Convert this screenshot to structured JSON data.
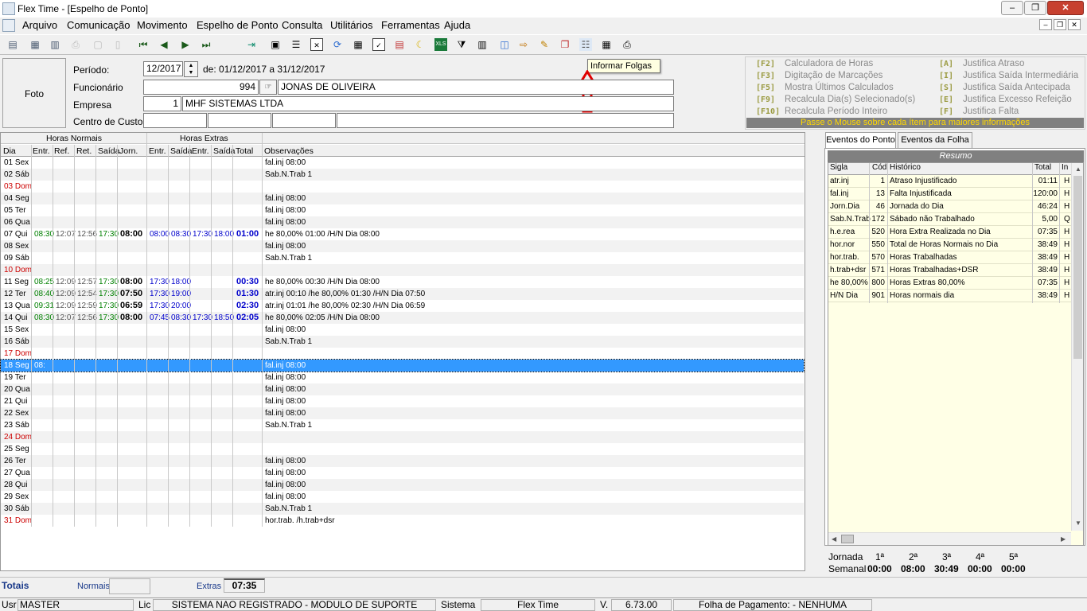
{
  "window": {
    "title": "Flex Time - [Espelho de Ponto]",
    "min_glyph": "–",
    "max_glyph": "❐",
    "close_glyph": "✕"
  },
  "menu": [
    "Arquivo",
    "Comunicação",
    "Movimento",
    "Espelho de Ponto",
    "Consulta",
    "Utilitários",
    "Ferramentas",
    "Ajuda"
  ],
  "tooltip": "Informar Folgas",
  "header": {
    "foto": "Foto",
    "periodo_label": "Período:",
    "periodo_value": "12/2017",
    "periodo_range": "de: 01/12/2017 a 31/12/2017",
    "funcionario_label": "Funcionário",
    "funcionario_id": "994",
    "funcionario_name": "JONAS DE OLIVEIRA",
    "empresa_label": "Empresa",
    "empresa_id": "1",
    "empresa_name": "MHF SISTEMAS LTDA",
    "centro_label": "Centro de Custos"
  },
  "shortcuts": [
    {
      "key": "[F2]",
      "label": "Calculadora de Horas"
    },
    {
      "key": "[F3]",
      "label": "Digitação de Marcações"
    },
    {
      "key": "[F5]",
      "label": "Mostra Últimos Calculados"
    },
    {
      "key": "[F9]",
      "label": "Recalcula Dia(s) Selecionado(s)"
    },
    {
      "key": "[F10]",
      "label": "Recalcula Período Inteiro"
    },
    {
      "key": "[A]",
      "label": "Justifica Atraso"
    },
    {
      "key": "[I]",
      "label": "Justifica Saída Intermediária"
    },
    {
      "key": "[S]",
      "label": "Justifica Saída Antecipada"
    },
    {
      "key": "[E]",
      "label": "Justifica Excesso Refeição"
    },
    {
      "key": "[F]",
      "label": "Justifica Falta"
    }
  ],
  "shortcut_hint": "Passe o Mouse sobre cada ítem para maiores informações",
  "grid": {
    "group_normais": "Horas Normais",
    "group_extras": "Horas Extras",
    "columns": [
      "Dia",
      "Entr.",
      "Ref.",
      "Ret.",
      "Saída",
      "Jorn.",
      "Entr.",
      "Saída",
      "Entr.",
      "Saída",
      "Total",
      "Observações"
    ],
    "rows": [
      {
        "dia": "01 Sex",
        "obs": "fal.inj 08:00"
      },
      {
        "dia": "02 Sáb",
        "obs": "Sab.N.Trab 1"
      },
      {
        "dia": "03 Dom",
        "red": true
      },
      {
        "dia": "04 Seg",
        "obs": "fal.inj 08:00"
      },
      {
        "dia": "05 Ter",
        "obs": "fal.inj 08:00"
      },
      {
        "dia": "06 Qua",
        "obs": "fal.inj 08:00"
      },
      {
        "dia": "07 Qui",
        "entr": "08:30",
        "ref": "12:07",
        "ret": "12:56",
        "saida": "17:30",
        "jorn": "08:00",
        "e1": "08:00",
        "s1": "08:30",
        "e2": "17:30",
        "s2": "18:00",
        "total": "01:00",
        "obs": "he 80,00% 01:00 /H/N Dia 08:00"
      },
      {
        "dia": "08 Sex",
        "obs": "fal.inj 08:00"
      },
      {
        "dia": "09 Sáb",
        "obs": "Sab.N.Trab 1"
      },
      {
        "dia": "10 Dom",
        "red": true
      },
      {
        "dia": "11 Seg",
        "entr": "08:25",
        "ref": "12:09",
        "ret": "12:57",
        "saida": "17:30",
        "jorn": "08:00",
        "e1": "17:30",
        "s1": "18:00",
        "total": "00:30",
        "obs": "he 80,00% 00:30 /H/N Dia 08:00"
      },
      {
        "dia": "12 Ter",
        "entr": "08:40",
        "ref": "12:09",
        "ret": "12:54",
        "saida": "17:30",
        "jorn": "07:50",
        "e1": "17:30",
        "s1": "19:00",
        "total": "01:30",
        "obs": "atr.inj 00:10 /he 80,00% 01:30 /H/N Dia 07:50"
      },
      {
        "dia": "13 Qua",
        "entr": "09:31",
        "ref": "12:09",
        "ret": "12:59",
        "saida": "17:30",
        "jorn": "06:59",
        "e1": "17:30",
        "s1": "20:00",
        "total": "02:30",
        "obs": "atr.inj 01:01 /he 80,00% 02:30 /H/N Dia 06:59"
      },
      {
        "dia": "14 Qui",
        "entr": "08:30",
        "ref": "12:07",
        "ret": "12:56",
        "saida": "17:30",
        "jorn": "08:00",
        "e1": "07:45",
        "s1": "08:30",
        "e2": "17:30",
        "s2": "18:50",
        "total": "02:05",
        "obs": "he 80,00% 02:05 /H/N Dia 08:00"
      },
      {
        "dia": "15 Sex",
        "obs": "fal.inj 08:00"
      },
      {
        "dia": "16 Sáb",
        "obs": "Sab.N.Trab 1"
      },
      {
        "dia": "17 Dom",
        "red": true
      },
      {
        "dia": "18 Seg",
        "entr": "08:",
        "obs": "fal.inj 08:00",
        "sel": true
      },
      {
        "dia": "19 Ter",
        "obs": "fal.inj 08:00"
      },
      {
        "dia": "20 Qua",
        "obs": "fal.inj 08:00"
      },
      {
        "dia": "21 Qui",
        "obs": "fal.inj 08:00"
      },
      {
        "dia": "22 Sex",
        "obs": "fal.inj 08:00"
      },
      {
        "dia": "23 Sáb",
        "obs": "Sab.N.Trab 1"
      },
      {
        "dia": "24 Dom",
        "red": true
      },
      {
        "dia": "25 Seg"
      },
      {
        "dia": "26 Ter",
        "obs": "fal.inj 08:00"
      },
      {
        "dia": "27 Qua",
        "obs": "fal.inj 08:00"
      },
      {
        "dia": "28 Qui",
        "obs": "fal.inj 08:00"
      },
      {
        "dia": "29 Sex",
        "obs": "fal.inj 08:00"
      },
      {
        "dia": "30 Sáb",
        "obs": "Sab.N.Trab 1"
      },
      {
        "dia": "31 Dom",
        "red": true,
        "obs": "hor.trab. /h.trab+dsr"
      }
    ]
  },
  "tabs": [
    "Eventos do Ponto",
    "Eventos da Folha"
  ],
  "resumo": {
    "title": "Resumo",
    "columns": [
      "Sigla",
      "Cód",
      "Histórico",
      "Total",
      "In"
    ],
    "rows": [
      [
        "atr.inj",
        "1",
        "Atraso Injustificado",
        "01:11",
        "H"
      ],
      [
        "fal.inj",
        "13",
        "Falta Injustificada",
        "120:00",
        "H"
      ],
      [
        "Jorn.Dia",
        "46",
        "Jornada do Dia",
        "46:24",
        "H"
      ],
      [
        "Sab.N.Trab",
        "172",
        "Sábado não Trabalhado",
        "5,00",
        "Q"
      ],
      [
        "h.e.rea",
        "520",
        "Hora Extra Realizada no Dia",
        "07:35",
        "H"
      ],
      [
        "hor.nor",
        "550",
        "Total de Horas Normais no Dia",
        "38:49",
        "H"
      ],
      [
        "hor.trab.",
        "570",
        "Horas Trabalhadas",
        "38:49",
        "H"
      ],
      [
        "h.trab+dsr",
        "571",
        "Horas Trabalhadas+DSR",
        "38:49",
        "H"
      ],
      [
        "he 80,00%",
        "800",
        "Horas Extras 80,00%",
        "07:35",
        "H"
      ],
      [
        "H/N Dia",
        "901",
        "Horas normais dia",
        "38:49",
        "H"
      ]
    ]
  },
  "jornada": {
    "label_jornada": "Jornada",
    "label_semanal": "Semanal",
    "weeks": [
      "1ª",
      "2ª",
      "3ª",
      "4ª",
      "5ª"
    ],
    "values": [
      "00:00",
      "08:00",
      "30:49",
      "00:00",
      "00:00"
    ]
  },
  "totais": {
    "label": "Totais",
    "normais_label": "Normais",
    "normais_value": "",
    "extras_label": "Extras",
    "extras_value": "07:35"
  },
  "status": {
    "usr_label": "Usr",
    "usr": "MASTER",
    "lic_label": "Lic",
    "lic": "SISTEMA NAO REGISTRADO - MODULO DE SUPORTE",
    "sistema_label": "Sistema",
    "sistema": "Flex Time",
    "v_label": "V.",
    "version": "6.73.00",
    "folha": "Folha de Pagamento:  - NENHUMA"
  },
  "colors": {
    "green": "#008000",
    "blue": "#0000cc",
    "red": "#cc0000",
    "selection": "#3399ff",
    "hint": "#ffd800"
  }
}
